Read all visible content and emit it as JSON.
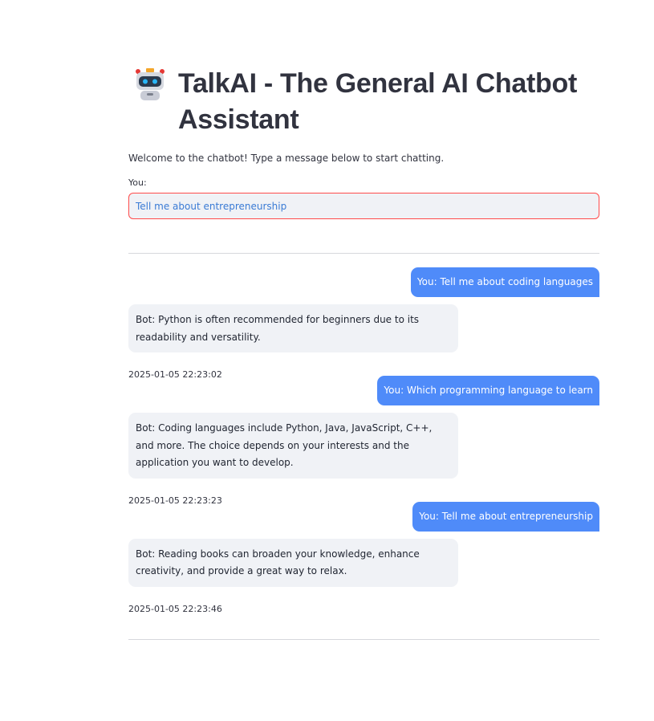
{
  "app": {
    "title": "TalkAI - The General AI Chatbot Assistant",
    "icon": "robot-icon",
    "intro": "Welcome to the chatbot! Type a message below to start chatting."
  },
  "input": {
    "label": "You:",
    "value": "Tell me about entrepreneurship"
  },
  "colors": {
    "user_bubble": "#4f8bf9",
    "bot_bubble": "#f0f2f6",
    "input_border": "#ff4b4b"
  },
  "messages": [
    {
      "user": "You: Tell me about coding languages",
      "bot": "Bot: Python is often recommended for beginners due to its readability and versatility.",
      "time": "2025-01-05 22:23:02"
    },
    {
      "user": "You: Which programming language to learn",
      "bot": "Bot: Coding languages include Python, Java, JavaScript, C++, and more. The choice depends on your interests and the application you want to develop.",
      "time": "2025-01-05 22:23:23"
    },
    {
      "user": "You: Tell me about entrepreneurship",
      "bot": "Bot: Reading books can broaden your knowledge, enhance creativity, and provide a great way to relax.",
      "time": "2025-01-05 22:23:46"
    }
  ]
}
